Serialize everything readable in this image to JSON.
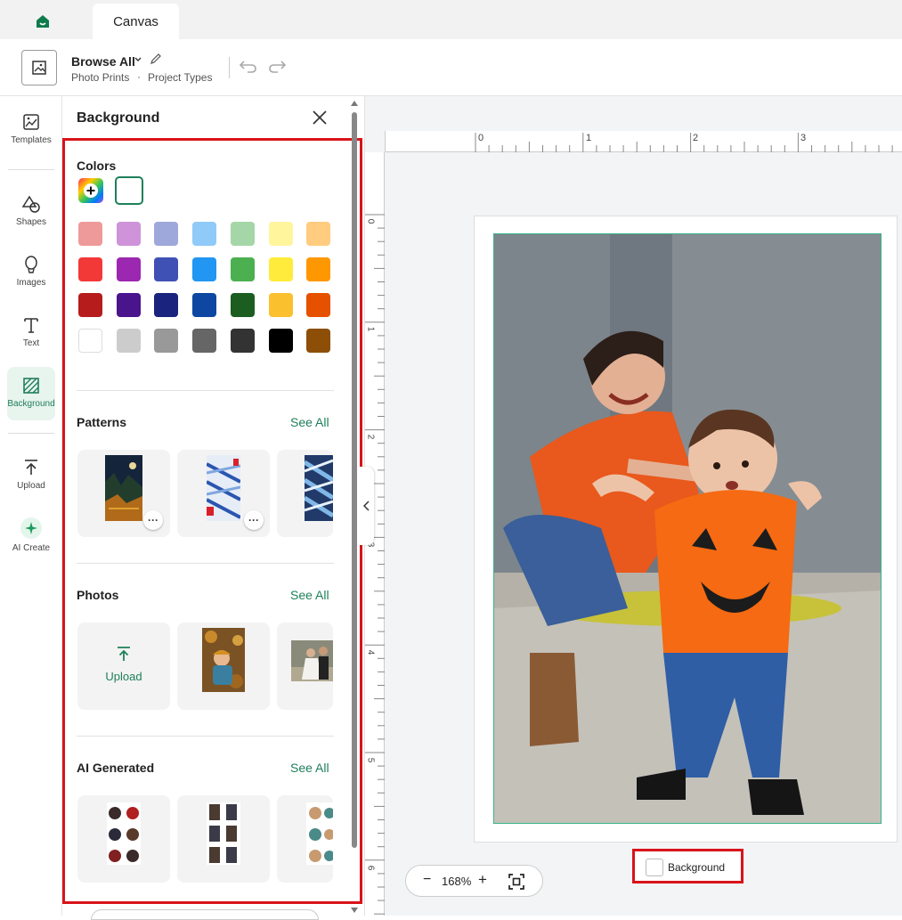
{
  "tabs": {
    "active": "Canvas"
  },
  "header": {
    "browse_label": "Browse All",
    "breadcrumb": [
      "Photo Prints",
      "Project Types"
    ],
    "breadcrumb_sep": "·"
  },
  "rail": {
    "items": [
      {
        "label": "Templates",
        "icon": "templates-icon"
      },
      {
        "label": "Shapes",
        "icon": "shapes-icon"
      },
      {
        "label": "Images",
        "icon": "images-icon"
      },
      {
        "label": "Text",
        "icon": "text-icon"
      },
      {
        "label": "Background",
        "icon": "background-icon",
        "active": true
      },
      {
        "label": "Upload",
        "icon": "upload-icon"
      },
      {
        "label": "AI Create",
        "icon": "ai-create-icon"
      }
    ]
  },
  "panel": {
    "title": "Background",
    "colors": {
      "title": "Colors",
      "palette": [
        [
          "#ef9a9a",
          "#ce93d8",
          "#9fa8da",
          "#90caf9",
          "#a5d6a7",
          "#fff59d",
          "#ffcc80"
        ],
        [
          "#f33838",
          "#9c27b0",
          "#3f51b5",
          "#2196f3",
          "#4caf50",
          "#ffeb3b",
          "#ff9800"
        ],
        [
          "#b71c1c",
          "#4a148c",
          "#1a237e",
          "#0d47a1",
          "#1b5e20",
          "#fbc02d",
          "#e65100"
        ],
        [
          "#ffffff",
          "#cccccc",
          "#999999",
          "#666666",
          "#333333",
          "#000000",
          "#8d4f08"
        ]
      ]
    },
    "patterns": {
      "title": "Patterns",
      "see_all": "See All"
    },
    "photos": {
      "title": "Photos",
      "see_all": "See All",
      "upload_label": "Upload"
    },
    "ai_generated": {
      "title": "AI Generated",
      "see_all": "See All"
    }
  },
  "ruler": {
    "top_labels": [
      "0",
      "1",
      "2",
      "3"
    ],
    "left_labels": [
      "0",
      "1",
      "2",
      "3",
      "4",
      "5",
      "6"
    ]
  },
  "zoom": {
    "minus": "−",
    "value": "168%",
    "plus": "+"
  },
  "background_chip": {
    "label": "Background"
  },
  "colors": {
    "accent": "#1e7f5a",
    "highlight": "#d9131a"
  }
}
